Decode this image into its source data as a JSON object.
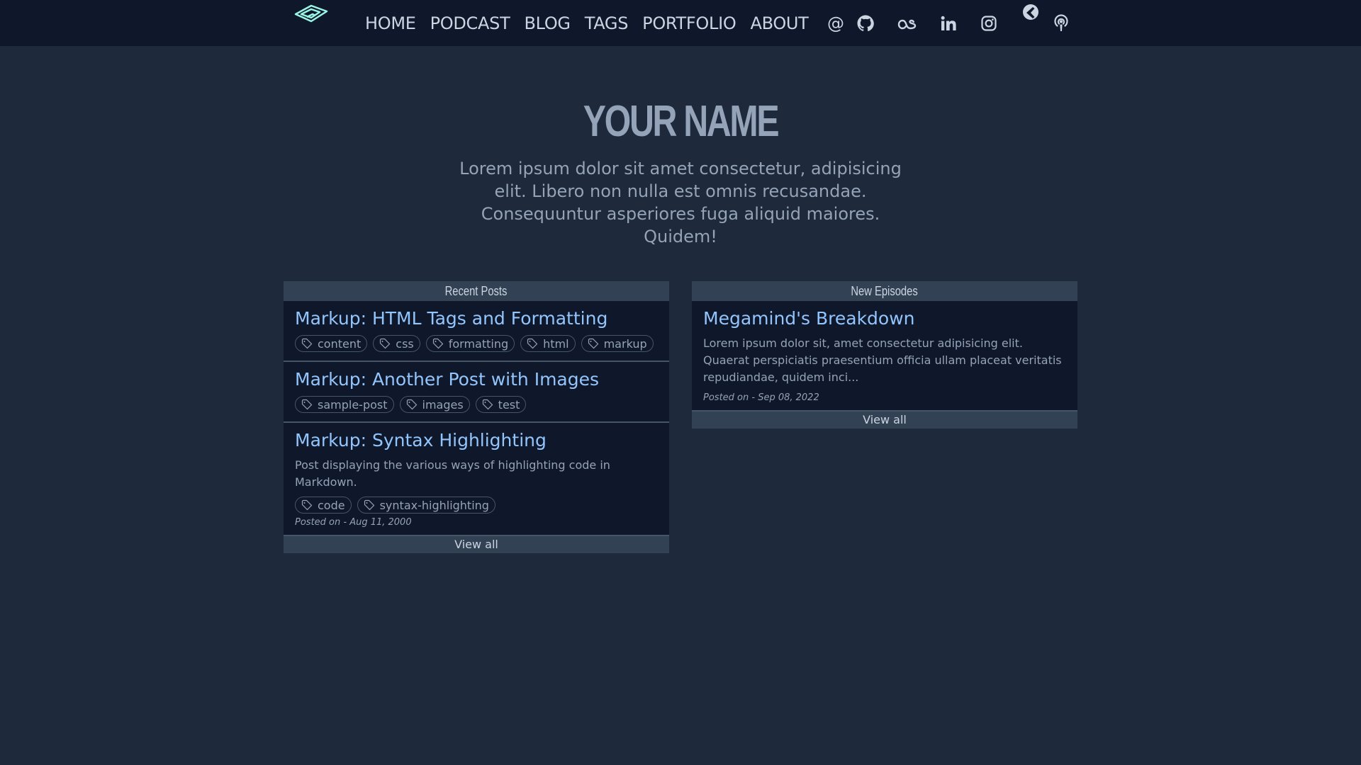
{
  "nav": {
    "links": [
      "HOME",
      "PODCAST",
      "BLOG",
      "TAGS",
      "PORTFOLIO",
      "ABOUT"
    ],
    "at_symbol": "@"
  },
  "hero": {
    "title": "YOUR NAME",
    "description": "Lorem ipsum dolor sit amet consectetur, adipisicing elit. Libero non nulla est omnis recusandae. Consequuntur asperiores fuga aliquid maiores. Quidem!"
  },
  "recent_posts": {
    "header": "Recent Posts",
    "posts": [
      {
        "title": "Markup: HTML Tags and Formatting",
        "tags": [
          "content",
          "css",
          "formatting",
          "html",
          "markup"
        ]
      },
      {
        "title": "Markup: Another Post with Images",
        "tags": [
          "sample-post",
          "images",
          "test"
        ]
      },
      {
        "title": "Markup: Syntax Highlighting",
        "description": "Post displaying the various ways of highlighting code in Markdown.",
        "tags": [
          "code",
          "syntax-highlighting"
        ],
        "posted": "Posted on - Aug 11, 2000"
      }
    ],
    "view_all": "View all"
  },
  "new_episodes": {
    "header": "New Episodes",
    "episodes": [
      {
        "title": "Megamind's Breakdown",
        "description": "Lorem ipsum dolor sit, amet consectetur adipisicing elit. Quaerat perspiciatis praesentium officia ullam placeat veritatis repudiandae, quidem inci...",
        "posted": "Posted on - Sep 08, 2022"
      }
    ],
    "view_all": "View all"
  },
  "colors": {
    "page_bg": "#1e293b",
    "nav_bg": "#0f172a",
    "card_bg": "#0f172a",
    "header_bg": "#334155",
    "link_blue": "#93c5fd",
    "muted_text": "#94a3b8"
  },
  "icons": [
    "logo-icon",
    "email-icon",
    "github-icon",
    "lastfm-icon",
    "linkedin-icon",
    "instagram-icon",
    "globe-icon",
    "podcast-icon",
    "tag-icon"
  ]
}
